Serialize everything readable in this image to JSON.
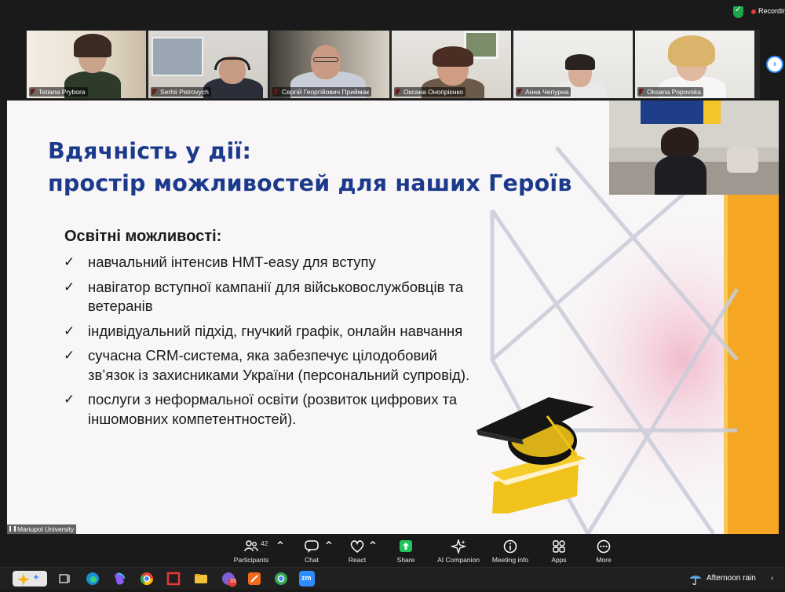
{
  "top_bar": {
    "recording_label": "Recordin"
  },
  "participants": [
    {
      "name": "Tetiana Prybora"
    },
    {
      "name": "Serhii Petrovych"
    },
    {
      "name": "Сергій Георгійович Приймак"
    },
    {
      "name": "Оксана Онопрієнко"
    },
    {
      "name": "Анна Чепурна"
    },
    {
      "name": "Oksana Popovska"
    }
  ],
  "slide": {
    "title_line1": "Вдячність у дії:",
    "title_line2": "простір можливостей для наших Героїв",
    "section_title": "Освітні можливості:",
    "bullets": [
      "навчальний інтенсив НМТ-easy для вступу",
      "навігатор вступної кампанії для військовослужбовців та ветеранів",
      "індивідуальний підхід, гнучкий графік, онлайн навчання",
      "сучасна CRM-система, яка забезпечує цілодобовий звʼязок із захисниками України (персональний супровід).",
      "послуги з неформальної освіти (розвиток цифрових та іншомовних компетентностей)."
    ],
    "title_color": "#1c3a8c",
    "accent_color": "#f5a623"
  },
  "share_label": "Mariupol University",
  "toolbar": {
    "participants_count": "42",
    "items": [
      {
        "label": "Participants",
        "icon": "participants-icon"
      },
      {
        "label": "Chat",
        "icon": "chat-icon"
      },
      {
        "label": "React",
        "icon": "heart-icon"
      },
      {
        "label": "Share",
        "icon": "share-arrow-icon"
      },
      {
        "label": "AI Companion",
        "icon": "sparkle-icon"
      },
      {
        "label": "Meeting info",
        "icon": "info-icon"
      },
      {
        "label": "Apps",
        "icon": "apps-icon"
      },
      {
        "label": "More",
        "icon": "more-icon"
      }
    ]
  },
  "taskbar": {
    "weather_text": "Afternoon rain",
    "app_badge": "33",
    "zoom_label": "zm"
  }
}
